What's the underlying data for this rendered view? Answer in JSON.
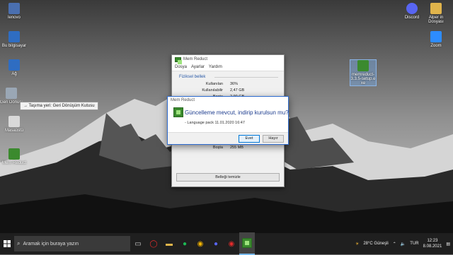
{
  "desktop_icons": [
    {
      "label": "lenovo",
      "color": "#4a6fb0"
    },
    {
      "label": "Bu bilgisayar",
      "color": "#2f6dc2"
    },
    {
      "label": "Ağ",
      "color": "#2f6dc2"
    },
    {
      "label": "Geri Dönüşüm Kutusu",
      "color": "#9aa7b5"
    },
    {
      "label": "Masaüstü",
      "color": "#d9d9d9"
    },
    {
      "label": "Mem Reduct",
      "color": "#3b8a2e"
    },
    {
      "label": "Discord",
      "color": "#5865f2"
    },
    {
      "label": "Alper in Dosyası",
      "color": "#e0b44b"
    },
    {
      "label": "Zoom",
      "color": "#2d8cff"
    },
    {
      "label": "memreduct-3.3.5-setup.exe",
      "color": "#3b8a2e"
    }
  ],
  "tooltip": {
    "text": "→ Taşıma yeri: Geri Dönüşüm Kutusu"
  },
  "window": {
    "title": "Mem Reduct",
    "menu": [
      "Dosya",
      "Ayarlar",
      "Yardım"
    ],
    "group_label": "Fiziksel bellek",
    "rows": [
      {
        "key": "Kullanılan",
        "value": "36%"
      },
      {
        "key": "Kullanılabilir",
        "value": "2,47 GB"
      },
      {
        "key": "Boşta",
        "value": "2,90 GB"
      }
    ],
    "bottom_row": {
      "key": "Boşta",
      "value": "255 MB"
    },
    "clean_button": "Belleği temizle"
  },
  "dialog": {
    "title": "Mem Reduct",
    "question": "Güncelleme mevcut, indirip kurulsun mu?",
    "pack": "- Language pack 11.01.2020 16:47",
    "yes": "Evet",
    "no": "Hayır"
  },
  "taskbar": {
    "search_placeholder": "Aramak için buraya yazın",
    "weather": "28°C Güneşli",
    "lang": "TUR",
    "time": "12:23",
    "date": "8.08.2021"
  }
}
